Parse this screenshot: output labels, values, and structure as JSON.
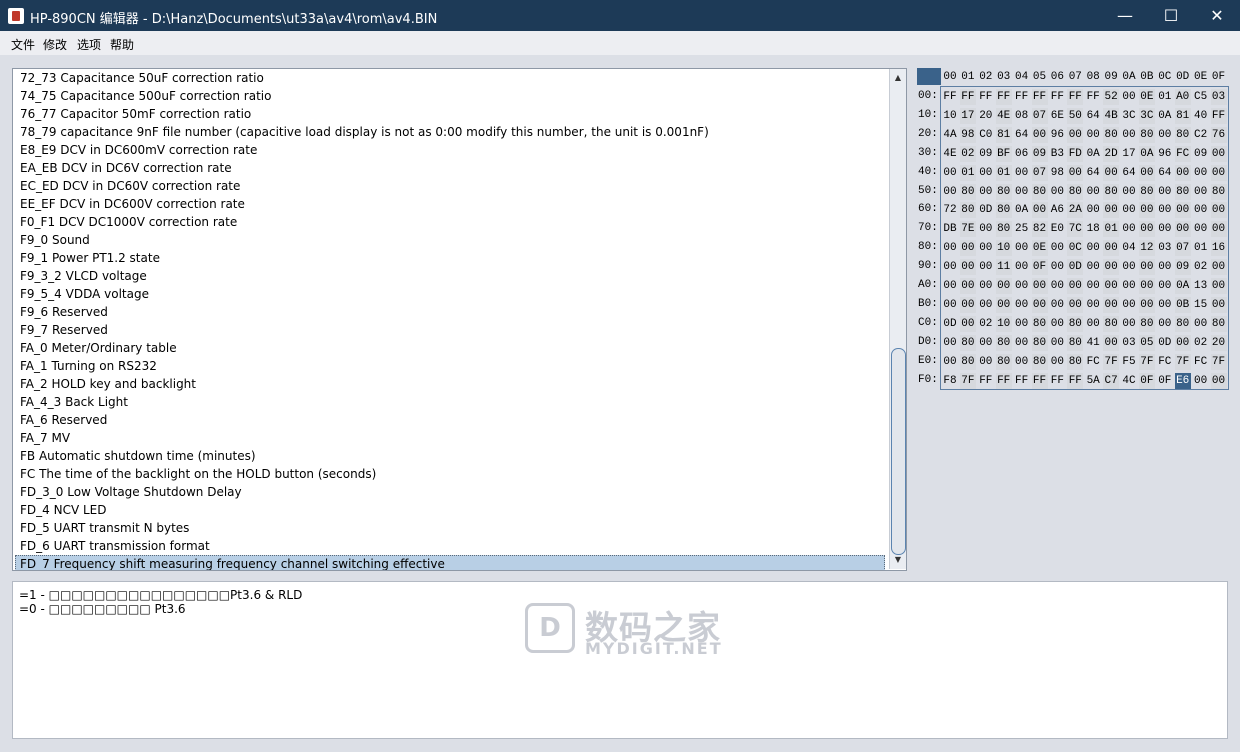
{
  "window": {
    "title": "HP-890CN 编辑器 - D:\\Hanz\\Documents\\ut33a\\av4\\rom\\av4.BIN",
    "minimize": "—",
    "maximize": "☐",
    "close": "✕"
  },
  "menu": [
    "文件",
    "修改",
    "选项",
    "帮助"
  ],
  "list": {
    "items": [
      "72_73 Capacitance 50uF correction ratio",
      "74_75 Capacitance 500uF correction ratio",
      "76_77 Capacitor 50mF correction ratio",
      "78_79 capacitance 9nF file number (capacitive load display is not as 0:00 modify this number, the unit is 0.001nF)",
      "E8_E9 DCV in DC600mV correction rate",
      "EA_EB DCV in DC6V correction rate",
      "EC_ED DCV in DC60V correction rate",
      "EE_EF DCV in DC600V correction rate",
      "F0_F1 DCV DC1000V correction rate",
      "F9_0 Sound",
      "F9_1 Power PT1.2 state",
      "F9_3_2 VLCD voltage",
      "F9_5_4 VDDA voltage",
      "F9_6 Reserved",
      "F9_7 Reserved",
      "FA_0 Meter/Ordinary table",
      "FA_1 Turning on RS232",
      "FA_2 HOLD key and backlight",
      "FA_4_3 Back Light",
      "FA_6 Reserved",
      "FA_7 MV",
      "FB Automatic shutdown time (minutes)",
      "FC The time of the backlight on the HOLD button (seconds)",
      "FD_3_0 Low Voltage Shutdown Delay",
      "FD_4 NCV LED",
      "FD_5 UART transmit N bytes",
      "FD_6 UART transmission format",
      "FD_7 Frequency shift measuring frequency channel switching effective"
    ],
    "selected_index": 27
  },
  "detail": {
    "lines": [
      "=1 - □□□□□□□□□□□□□□□□Pt3.6 & RLD",
      "=0 - □□□□□□□□□ Pt3.6"
    ]
  },
  "watermark": {
    "logo": "D",
    "cn": "数码之家",
    "en": "MYDIGIT.NET"
  },
  "hex": {
    "columns": [
      "00",
      "01",
      "02",
      "03",
      "04",
      "05",
      "06",
      "07",
      "08",
      "09",
      "0A",
      "0B",
      "0C",
      "0D",
      "0E",
      "0F"
    ],
    "rows": [
      {
        "label": "00:",
        "bytes": [
          "FF",
          "FF",
          "FF",
          "FF",
          "FF",
          "FF",
          "FF",
          "FF",
          "FF",
          "52",
          "00",
          "0E",
          "01",
          "A0",
          "C5",
          "03"
        ]
      },
      {
        "label": "10:",
        "bytes": [
          "10",
          "17",
          "20",
          "4E",
          "08",
          "07",
          "6E",
          "50",
          "64",
          "4B",
          "3C",
          "3C",
          "0A",
          "81",
          "40",
          "FF"
        ]
      },
      {
        "label": "20:",
        "bytes": [
          "4A",
          "98",
          "C0",
          "81",
          "64",
          "00",
          "96",
          "00",
          "00",
          "80",
          "00",
          "80",
          "00",
          "80",
          "C2",
          "76"
        ]
      },
      {
        "label": "30:",
        "bytes": [
          "4E",
          "02",
          "09",
          "BF",
          "06",
          "09",
          "B3",
          "FD",
          "0A",
          "2D",
          "17",
          "0A",
          "96",
          "FC",
          "09",
          "00"
        ]
      },
      {
        "label": "40:",
        "bytes": [
          "00",
          "01",
          "00",
          "01",
          "00",
          "07",
          "98",
          "00",
          "64",
          "00",
          "64",
          "00",
          "64",
          "00",
          "00",
          "00"
        ]
      },
      {
        "label": "50:",
        "bytes": [
          "00",
          "80",
          "00",
          "80",
          "00",
          "80",
          "00",
          "80",
          "00",
          "80",
          "00",
          "80",
          "00",
          "80",
          "00",
          "80"
        ]
      },
      {
        "label": "60:",
        "bytes": [
          "72",
          "80",
          "0D",
          "80",
          "0A",
          "00",
          "A6",
          "2A",
          "00",
          "00",
          "00",
          "00",
          "00",
          "00",
          "00",
          "00"
        ]
      },
      {
        "label": "70:",
        "bytes": [
          "DB",
          "7E",
          "00",
          "80",
          "25",
          "82",
          "E0",
          "7C",
          "18",
          "01",
          "00",
          "00",
          "00",
          "00",
          "00",
          "00"
        ]
      },
      {
        "label": "80:",
        "bytes": [
          "00",
          "00",
          "00",
          "10",
          "00",
          "0E",
          "00",
          "0C",
          "00",
          "00",
          "04",
          "12",
          "03",
          "07",
          "01",
          "16"
        ]
      },
      {
        "label": "90:",
        "bytes": [
          "00",
          "00",
          "00",
          "11",
          "00",
          "0F",
          "00",
          "0D",
          "00",
          "00",
          "00",
          "00",
          "00",
          "09",
          "02",
          "00"
        ]
      },
      {
        "label": "A0:",
        "bytes": [
          "00",
          "00",
          "00",
          "00",
          "00",
          "00",
          "00",
          "00",
          "00",
          "00",
          "00",
          "00",
          "00",
          "0A",
          "13",
          "00"
        ]
      },
      {
        "label": "B0:",
        "bytes": [
          "00",
          "00",
          "00",
          "00",
          "00",
          "00",
          "00",
          "00",
          "00",
          "00",
          "00",
          "00",
          "00",
          "0B",
          "15",
          "00"
        ]
      },
      {
        "label": "C0:",
        "bytes": [
          "0D",
          "00",
          "02",
          "10",
          "00",
          "80",
          "00",
          "80",
          "00",
          "80",
          "00",
          "80",
          "00",
          "80",
          "00",
          "80"
        ]
      },
      {
        "label": "D0:",
        "bytes": [
          "00",
          "80",
          "00",
          "80",
          "00",
          "80",
          "00",
          "80",
          "41",
          "00",
          "03",
          "05",
          "0D",
          "00",
          "02",
          "20"
        ]
      },
      {
        "label": "E0:",
        "bytes": [
          "00",
          "80",
          "00",
          "80",
          "00",
          "80",
          "00",
          "80",
          "FC",
          "7F",
          "F5",
          "7F",
          "FC",
          "7F",
          "FC",
          "7F"
        ]
      },
      {
        "label": "F0:",
        "bytes": [
          "F8",
          "7F",
          "FF",
          "FF",
          "FF",
          "FF",
          "FF",
          "FF",
          "5A",
          "C7",
          "4C",
          "0F",
          "0F",
          "E6",
          "00",
          "00"
        ]
      }
    ],
    "selected": {
      "row": 15,
      "col": 13
    },
    "colors": {
      "selected_bg": "#3a628a",
      "shade": "#d6d9de"
    }
  }
}
